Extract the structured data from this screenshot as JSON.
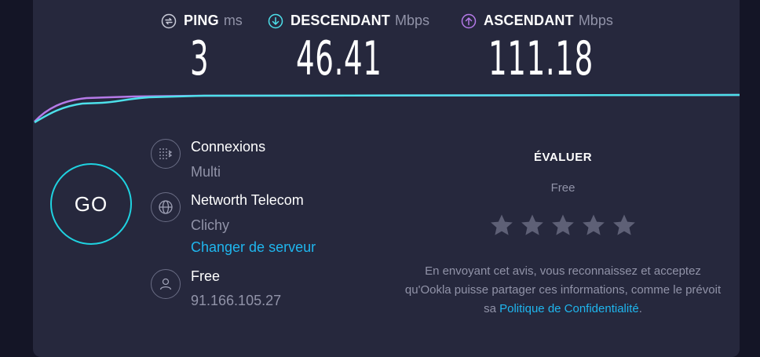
{
  "metrics": {
    "ping": {
      "name": "PING",
      "unit": "ms",
      "value": "3",
      "icon": "ping-icon"
    },
    "download": {
      "name": "DESCENDANT",
      "unit": "Mbps",
      "value": "46.41",
      "icon": "download-arrow-icon"
    },
    "upload": {
      "name": "ASCENDANT",
      "unit": "Mbps",
      "value": "111.18",
      "icon": "upload-arrow-icon"
    }
  },
  "colors": {
    "download": "#4de0ea",
    "upload": "#b57ae8",
    "accent": "#1fd2e0",
    "link": "#1fb6ee"
  },
  "go_label": "GO",
  "connections": {
    "title": "Connexions",
    "value": "Multi",
    "icon": "connections-icon"
  },
  "server": {
    "title": "Networth Telecom",
    "location": "Clichy",
    "change_link": "Changer de serveur",
    "icon": "globe-icon"
  },
  "isp": {
    "name": "Free",
    "ip": "91.166.105.27",
    "icon": "user-icon"
  },
  "rating": {
    "title": "ÉVALUER",
    "isp": "Free",
    "star_count": 5
  },
  "disclaimer": {
    "text": "En envoyant cet avis, vous reconnaissez et acceptez qu'Ookla puisse partager ces informations, comme le prévoit sa ",
    "link": "Politique de Confidentialité",
    "end": "."
  }
}
